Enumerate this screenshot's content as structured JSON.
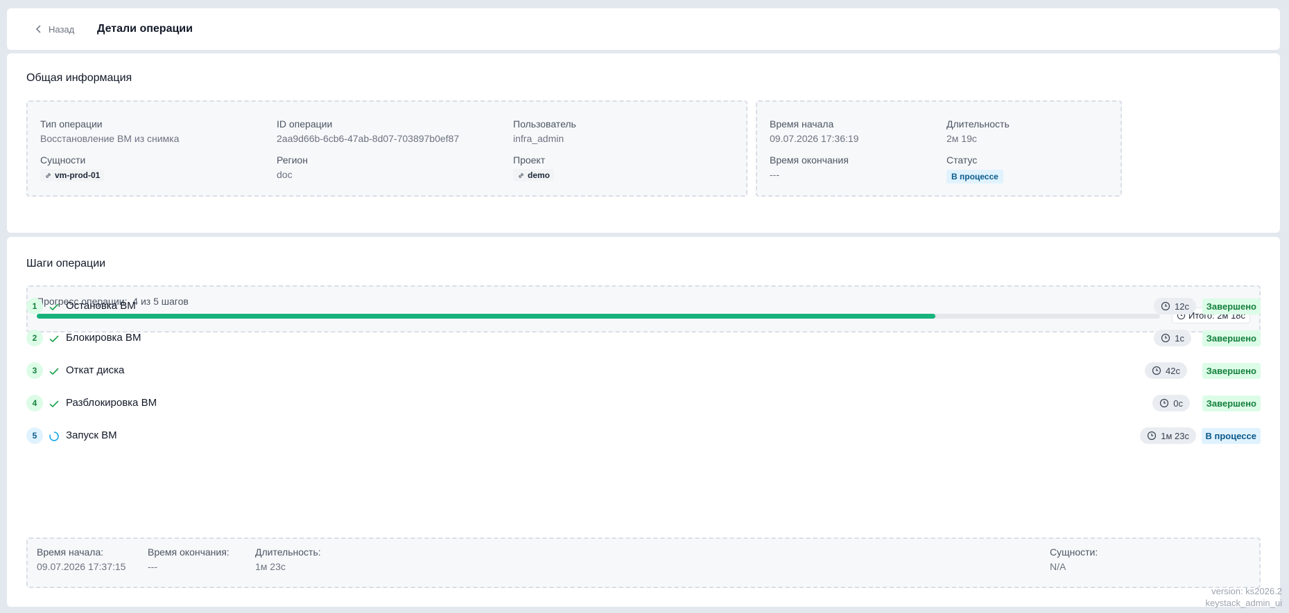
{
  "header": {
    "back_label": "Назад",
    "title": "Детали операции"
  },
  "general": {
    "title": "Общая информация",
    "operation_type": {
      "label": "Тип операции",
      "value": "Восстановление ВМ из снимка"
    },
    "operation_id": {
      "label": "ID операции",
      "value": "2aa9d66b-6cb6-47ab-8d07-703897b0ef87"
    },
    "user": {
      "label": "Пользователь",
      "value": "infra_admin"
    },
    "entities": {
      "label": "Сущности",
      "value": "vm-prod-01"
    },
    "region": {
      "label": "Регион",
      "value": "doc"
    },
    "project": {
      "label": "Проект",
      "value": "demo"
    },
    "start_time": {
      "label": "Время начала",
      "value": "09.07.2026 17:36:19"
    },
    "duration": {
      "label": "Длительность",
      "value": "2м 19с"
    },
    "end_time": {
      "label": "Время окончания",
      "value": "---"
    },
    "status": {
      "label": "Статус",
      "value": "В процессе"
    }
  },
  "steps": {
    "title": "Шаги операции",
    "progress_label": "Прогресс операции:",
    "progress_text": "4 из 5 шагов",
    "progress_fraction": 0.8,
    "total_time": "Итого: 2м 18с",
    "items": [
      {
        "num": "1",
        "name": "Остановка ВМ",
        "time": "12с",
        "status": "Завершено",
        "state": "done"
      },
      {
        "num": "2",
        "name": "Блокировка ВМ",
        "time": "1с",
        "status": "Завершено",
        "state": "done"
      },
      {
        "num": "3",
        "name": "Откат диска",
        "time": "42с",
        "status": "Завершено",
        "state": "done"
      },
      {
        "num": "4",
        "name": "Разблокировка ВМ",
        "time": "0с",
        "status": "Завершено",
        "state": "done"
      },
      {
        "num": "5",
        "name": "Запуск ВМ",
        "time": "1м 23с",
        "status": "В процессе",
        "state": "progress"
      }
    ],
    "detail": {
      "start_label": "Время начала:",
      "start_value": "09.07.2026 17:37:15",
      "end_label": "Время окончания:",
      "end_value": "---",
      "duration_label": "Длительность:",
      "duration_value": "1м 23с",
      "entities_label": "Сущности:",
      "entities_value": "N/A"
    }
  },
  "footer": {
    "version": "version: ks2026.2",
    "app": "keystack_admin_ui"
  },
  "colors": {
    "accent_green": "#16b37d",
    "done_badge": "#15803d",
    "progress_badge": "#0b5a8a"
  }
}
